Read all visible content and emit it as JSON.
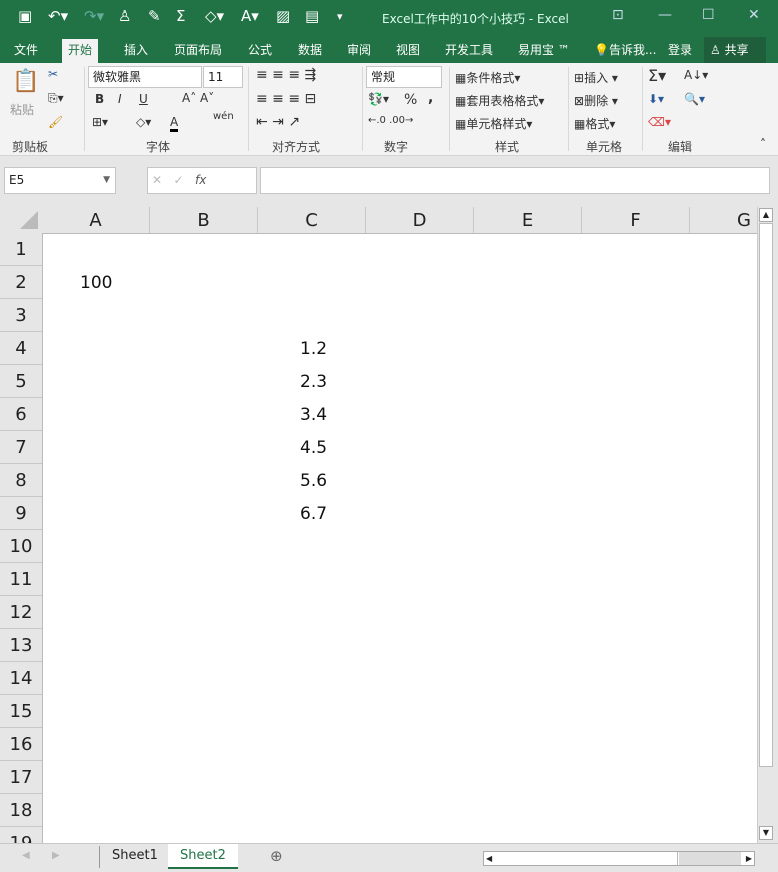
{
  "window": {
    "title": "Excel工作中的10个小技巧 - Excel"
  },
  "tabs": [
    "文件",
    "开始",
    "插入",
    "页面布局",
    "公式",
    "数据",
    "审阅",
    "视图",
    "开发工具",
    "易用宝 ™"
  ],
  "tell_me": "告诉我...",
  "login": "登录",
  "share": "共享",
  "ribbon": {
    "clipboard": {
      "label": "剪贴板",
      "paste": "粘贴"
    },
    "font": {
      "label": "字体",
      "name": "微软雅黑",
      "size": "11",
      "bold": "B",
      "italic": "I",
      "underline": "U",
      "phonetic": "wén"
    },
    "alignment": {
      "label": "对齐方式"
    },
    "number": {
      "label": "数字",
      "format": "常规",
      "percent": "%",
      "comma": ","
    },
    "styles": {
      "label": "样式",
      "conditional": "条件格式",
      "table": "套用表格格式",
      "cell": "单元格样式"
    },
    "cells": {
      "label": "单元格",
      "insert": "插入",
      "delete": "删除",
      "format": "格式"
    },
    "editing": {
      "label": "编辑"
    }
  },
  "formula_bar": {
    "name_box": "E5",
    "fx": "fx",
    "value": ""
  },
  "columns": [
    "A",
    "B",
    "C",
    "D",
    "E",
    "F",
    "G"
  ],
  "rows": [
    "1",
    "2",
    "3",
    "4",
    "5",
    "6",
    "7",
    "8",
    "9",
    "10",
    "11",
    "12",
    "13",
    "14",
    "15",
    "16",
    "17",
    "18",
    "19"
  ],
  "cells": {
    "A2": "100",
    "C4": "1.2",
    "C5": "2.3",
    "C6": "3.4",
    "C7": "4.5",
    "C8": "5.6",
    "C9": "6.7"
  },
  "sheets": [
    "Sheet1",
    "Sheet2"
  ],
  "active_sheet": "Sheet2",
  "colors": {
    "accent": "#217346"
  }
}
